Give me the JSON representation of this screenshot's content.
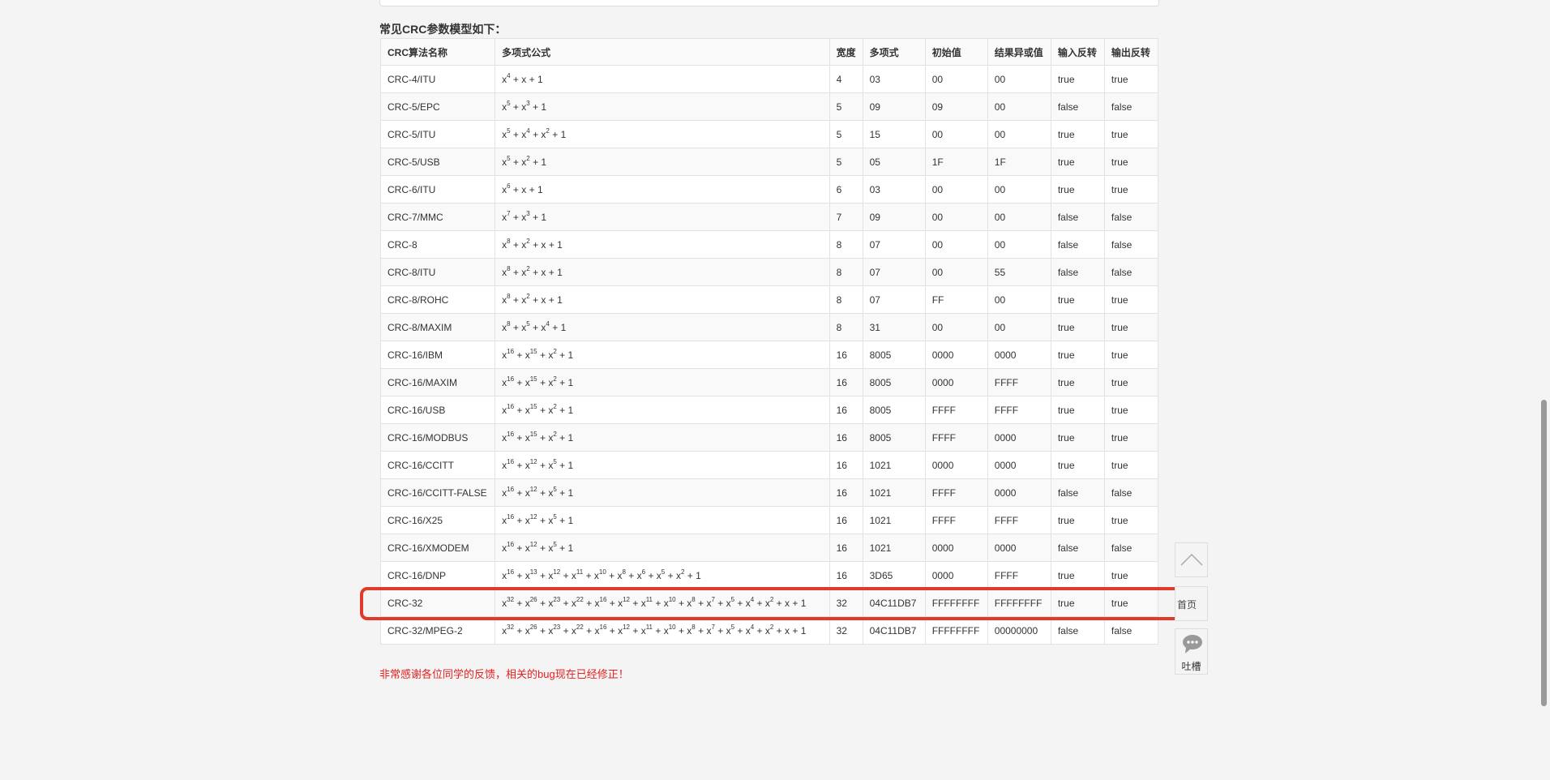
{
  "section_title": "常见CRC参数模型如下：",
  "headers": [
    "CRC算法名称",
    "多项式公式",
    "宽度",
    "多项式",
    "初始值",
    "结果异或值",
    "输入反转",
    "输出反转"
  ],
  "rows": [
    {
      "name": "CRC-4/ITU",
      "formula": [
        [
          "x",
          "4"
        ],
        [
          "x",
          ""
        ],
        [
          "1",
          ""
        ]
      ],
      "width": "4",
      "poly": "03",
      "init": "00",
      "xorout": "00",
      "refin": "true",
      "refout": "true"
    },
    {
      "name": "CRC-5/EPC",
      "formula": [
        [
          "x",
          "5"
        ],
        [
          "x",
          "3"
        ],
        [
          "1",
          ""
        ]
      ],
      "width": "5",
      "poly": "09",
      "init": "09",
      "xorout": "00",
      "refin": "false",
      "refout": "false"
    },
    {
      "name": "CRC-5/ITU",
      "formula": [
        [
          "x",
          "5"
        ],
        [
          "x",
          "4"
        ],
        [
          "x",
          "2"
        ],
        [
          "1",
          ""
        ]
      ],
      "width": "5",
      "poly": "15",
      "init": "00",
      "xorout": "00",
      "refin": "true",
      "refout": "true"
    },
    {
      "name": "CRC-5/USB",
      "formula": [
        [
          "x",
          "5"
        ],
        [
          "x",
          "2"
        ],
        [
          "1",
          ""
        ]
      ],
      "width": "5",
      "poly": "05",
      "init": "1F",
      "xorout": "1F",
      "refin": "true",
      "refout": "true"
    },
    {
      "name": "CRC-6/ITU",
      "formula": [
        [
          "x",
          "6"
        ],
        [
          "x",
          ""
        ],
        [
          "1",
          ""
        ]
      ],
      "width": "6",
      "poly": "03",
      "init": "00",
      "xorout": "00",
      "refin": "true",
      "refout": "true"
    },
    {
      "name": "CRC-7/MMC",
      "formula": [
        [
          "x",
          "7"
        ],
        [
          "x",
          "3"
        ],
        [
          "1",
          ""
        ]
      ],
      "width": "7",
      "poly": "09",
      "init": "00",
      "xorout": "00",
      "refin": "false",
      "refout": "false"
    },
    {
      "name": "CRC-8",
      "formula": [
        [
          "x",
          "8"
        ],
        [
          "x",
          "2"
        ],
        [
          "x",
          ""
        ],
        [
          "1",
          ""
        ]
      ],
      "width": "8",
      "poly": "07",
      "init": "00",
      "xorout": "00",
      "refin": "false",
      "refout": "false"
    },
    {
      "name": "CRC-8/ITU",
      "formula": [
        [
          "x",
          "8"
        ],
        [
          "x",
          "2"
        ],
        [
          "x",
          ""
        ],
        [
          "1",
          ""
        ]
      ],
      "width": "8",
      "poly": "07",
      "init": "00",
      "xorout": "55",
      "refin": "false",
      "refout": "false"
    },
    {
      "name": "CRC-8/ROHC",
      "formula": [
        [
          "x",
          "8"
        ],
        [
          "x",
          "2"
        ],
        [
          "x",
          ""
        ],
        [
          "1",
          ""
        ]
      ],
      "width": "8",
      "poly": "07",
      "init": "FF",
      "xorout": "00",
      "refin": "true",
      "refout": "true"
    },
    {
      "name": "CRC-8/MAXIM",
      "formula": [
        [
          "x",
          "8"
        ],
        [
          "x",
          "5"
        ],
        [
          "x",
          "4"
        ],
        [
          "1",
          ""
        ]
      ],
      "width": "8",
      "poly": "31",
      "init": "00",
      "xorout": "00",
      "refin": "true",
      "refout": "true"
    },
    {
      "name": "CRC-16/IBM",
      "formula": [
        [
          "x",
          "16"
        ],
        [
          "x",
          "15"
        ],
        [
          "x",
          "2"
        ],
        [
          "1",
          ""
        ]
      ],
      "width": "16",
      "poly": "8005",
      "init": "0000",
      "xorout": "0000",
      "refin": "true",
      "refout": "true"
    },
    {
      "name": "CRC-16/MAXIM",
      "formula": [
        [
          "x",
          "16"
        ],
        [
          "x",
          "15"
        ],
        [
          "x",
          "2"
        ],
        [
          "1",
          ""
        ]
      ],
      "width": "16",
      "poly": "8005",
      "init": "0000",
      "xorout": "FFFF",
      "refin": "true",
      "refout": "true"
    },
    {
      "name": "CRC-16/USB",
      "formula": [
        [
          "x",
          "16"
        ],
        [
          "x",
          "15"
        ],
        [
          "x",
          "2"
        ],
        [
          "1",
          ""
        ]
      ],
      "width": "16",
      "poly": "8005",
      "init": "FFFF",
      "xorout": "FFFF",
      "refin": "true",
      "refout": "true"
    },
    {
      "name": "CRC-16/MODBUS",
      "formula": [
        [
          "x",
          "16"
        ],
        [
          "x",
          "15"
        ],
        [
          "x",
          "2"
        ],
        [
          "1",
          ""
        ]
      ],
      "width": "16",
      "poly": "8005",
      "init": "FFFF",
      "xorout": "0000",
      "refin": "true",
      "refout": "true"
    },
    {
      "name": "CRC-16/CCITT",
      "formula": [
        [
          "x",
          "16"
        ],
        [
          "x",
          "12"
        ],
        [
          "x",
          "5"
        ],
        [
          "1",
          ""
        ]
      ],
      "width": "16",
      "poly": "1021",
      "init": "0000",
      "xorout": "0000",
      "refin": "true",
      "refout": "true"
    },
    {
      "name": "CRC-16/CCITT-FALSE",
      "formula": [
        [
          "x",
          "16"
        ],
        [
          "x",
          "12"
        ],
        [
          "x",
          "5"
        ],
        [
          "1",
          ""
        ]
      ],
      "width": "16",
      "poly": "1021",
      "init": "FFFF",
      "xorout": "0000",
      "refin": "false",
      "refout": "false"
    },
    {
      "name": "CRC-16/X25",
      "formula": [
        [
          "x",
          "16"
        ],
        [
          "x",
          "12"
        ],
        [
          "x",
          "5"
        ],
        [
          "1",
          ""
        ]
      ],
      "width": "16",
      "poly": "1021",
      "init": "FFFF",
      "xorout": "FFFF",
      "refin": "true",
      "refout": "true"
    },
    {
      "name": "CRC-16/XMODEM",
      "formula": [
        [
          "x",
          "16"
        ],
        [
          "x",
          "12"
        ],
        [
          "x",
          "5"
        ],
        [
          "1",
          ""
        ]
      ],
      "width": "16",
      "poly": "1021",
      "init": "0000",
      "xorout": "0000",
      "refin": "false",
      "refout": "false"
    },
    {
      "name": "CRC-16/DNP",
      "formula": [
        [
          "x",
          "16"
        ],
        [
          "x",
          "13"
        ],
        [
          "x",
          "12"
        ],
        [
          "x",
          "11"
        ],
        [
          "x",
          "10"
        ],
        [
          "x",
          "8"
        ],
        [
          "x",
          "6"
        ],
        [
          "x",
          "5"
        ],
        [
          "x",
          "2"
        ],
        [
          "1",
          ""
        ]
      ],
      "width": "16",
      "poly": "3D65",
      "init": "0000",
      "xorout": "FFFF",
      "refin": "true",
      "refout": "true"
    },
    {
      "name": "CRC-32",
      "formula": [
        [
          "x",
          "32"
        ],
        [
          "x",
          "26"
        ],
        [
          "x",
          "23"
        ],
        [
          "x",
          "22"
        ],
        [
          "x",
          "16"
        ],
        [
          "x",
          "12"
        ],
        [
          "x",
          "11"
        ],
        [
          "x",
          "10"
        ],
        [
          "x",
          "8"
        ],
        [
          "x",
          "7"
        ],
        [
          "x",
          "5"
        ],
        [
          "x",
          "4"
        ],
        [
          "x",
          "2"
        ],
        [
          "x",
          ""
        ],
        [
          "1",
          ""
        ]
      ],
      "width": "32",
      "poly": "04C11DB7",
      "init": "FFFFFFFF",
      "xorout": "FFFFFFFF",
      "refin": "true",
      "refout": "true"
    },
    {
      "name": "CRC-32/MPEG-2",
      "formula": [
        [
          "x",
          "32"
        ],
        [
          "x",
          "26"
        ],
        [
          "x",
          "23"
        ],
        [
          "x",
          "22"
        ],
        [
          "x",
          "16"
        ],
        [
          "x",
          "12"
        ],
        [
          "x",
          "11"
        ],
        [
          "x",
          "10"
        ],
        [
          "x",
          "8"
        ],
        [
          "x",
          "7"
        ],
        [
          "x",
          "5"
        ],
        [
          "x",
          "4"
        ],
        [
          "x",
          "2"
        ],
        [
          "x",
          ""
        ],
        [
          "1",
          ""
        ]
      ],
      "width": "32",
      "poly": "04C11DB7",
      "init": "FFFFFFFF",
      "xorout": "00000000",
      "refin": "false",
      "refout": "false"
    }
  ],
  "highlight_row": "CRC-32",
  "notice": "非常感谢各位同学的反馈，相关的bug现在已经修正！",
  "side": {
    "top_icon": "chevron-up-icon",
    "home_label": "首页",
    "feedback_icon": "chat-bubble-icon",
    "feedback_label": "吐槽"
  },
  "colors": {
    "highlight": "#e03a2a",
    "notice": "#e52020"
  }
}
